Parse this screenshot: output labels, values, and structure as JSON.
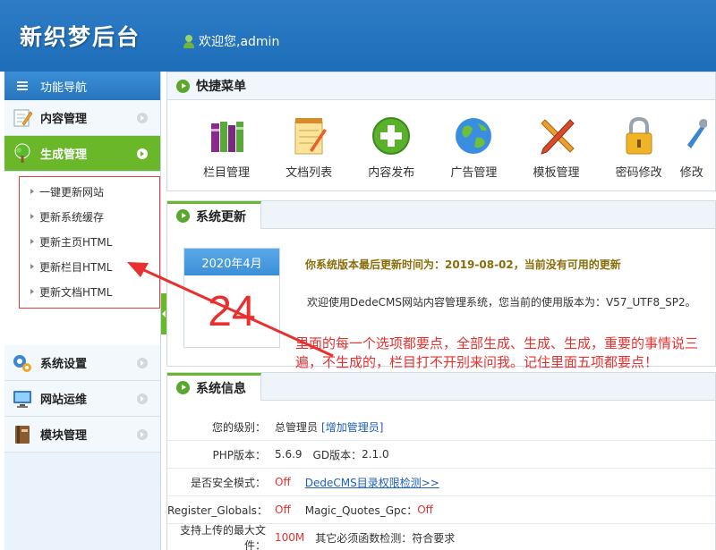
{
  "header": {
    "brand": "新织梦后台",
    "welcome": "欢迎您,admin"
  },
  "sidebar": {
    "nav_title": "功能导航",
    "items": [
      {
        "label": "内容管理"
      },
      {
        "label": "生成管理"
      },
      {
        "label": "系统设置"
      },
      {
        "label": "网站运维"
      },
      {
        "label": "模块管理"
      }
    ],
    "sub_items": [
      "一键更新网站",
      "更新系统缓存",
      "更新主页HTML",
      "更新栏目HTML",
      "更新文档HTML"
    ]
  },
  "quick_menu": {
    "title": "快捷菜单",
    "items": [
      "栏目管理",
      "文档列表",
      "内容发布",
      "广告管理",
      "模板管理",
      "密码修改",
      "修改"
    ]
  },
  "system_update": {
    "title": "系统更新",
    "month": "2020年4月",
    "day": "24",
    "line1": "你系统版本最后更新时间为：2019-08-02，当前没有可用的更新",
    "line2": "欢迎使用DedeCMS网站内容管理系统，您当前的使用版本为：V57_UTF8_SP2。"
  },
  "annotation": "里面的每一个选项都要点，全部生成、生成、生成，重要的事情说三遍，不生成的，栏目打不开别来问我。记住里面五项都要点！",
  "system_info": {
    "title": "系统信息",
    "level_label": "您的级别：",
    "level_value": "总管理员",
    "add_admin": "[增加管理员]",
    "php_label": "PHP版本：",
    "php_value": "5.6.9",
    "gd_label": "GD版本：",
    "gd_value": "2.1.0",
    "safe_label": "是否安全模式：",
    "safe_value": "Off",
    "perm_link": "DedeCMS目录权限检测>>",
    "rg_label": "Register_Globals：",
    "rg_value": "Off",
    "mq_label": "Magic_Quotes_Gpc：",
    "mq_value": "Off",
    "upload_label": "支持上传的最大文件：",
    "upload_value": "100M",
    "func_label": "其它必须函数检测：",
    "func_value": "符合要求"
  }
}
